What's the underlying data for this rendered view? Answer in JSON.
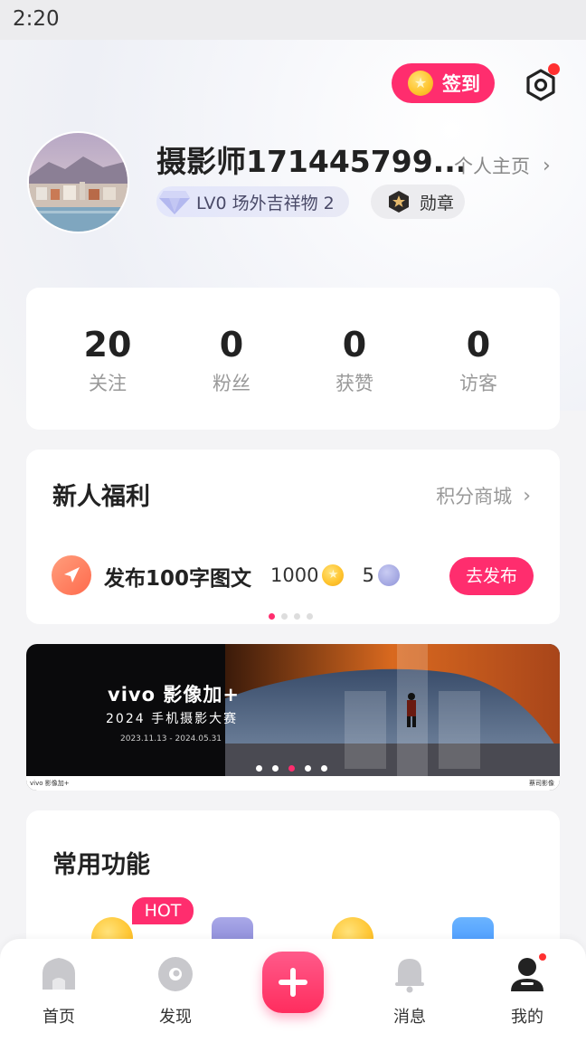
{
  "status_bar": {
    "time": "2:20"
  },
  "header": {
    "checkin_label": "签到",
    "username": "摄影师171445799...",
    "homepage_link": "个人主页",
    "level_text": "LV0 场外吉祥物  2",
    "medal_label": "勋章",
    "accent_color": "#ff2d6e"
  },
  "stats": [
    {
      "value": "20",
      "label": "关注"
    },
    {
      "value": "0",
      "label": "粉丝"
    },
    {
      "value": "0",
      "label": "获赞"
    },
    {
      "value": "0",
      "label": "访客"
    }
  ],
  "welfare": {
    "title": "新人福利",
    "points_mall": "积分商城",
    "task": {
      "text": "发布100字图文",
      "points": "1000",
      "bonus": "5",
      "button": "去发布"
    },
    "carousel": {
      "count": 4,
      "active": 0
    }
  },
  "banner": {
    "brand": "vivo 影像加+",
    "contest": "2024 手机摄影大赛",
    "dates": "2023.11.13 - 2024.05.31",
    "footer_left": "vivo 影像加+",
    "footer_right": "蔡司影像",
    "carousel": {
      "count": 5,
      "active": 2
    }
  },
  "functions": {
    "title": "常用功能",
    "hot_tag": "HOT"
  },
  "tabbar": {
    "items": [
      {
        "label": "首页",
        "icon": "home-icon"
      },
      {
        "label": "发现",
        "icon": "discover-icon"
      },
      {
        "label": "",
        "icon": "add-icon"
      },
      {
        "label": "消息",
        "icon": "bell-icon"
      },
      {
        "label": "我的",
        "icon": "profile-icon"
      }
    ]
  }
}
